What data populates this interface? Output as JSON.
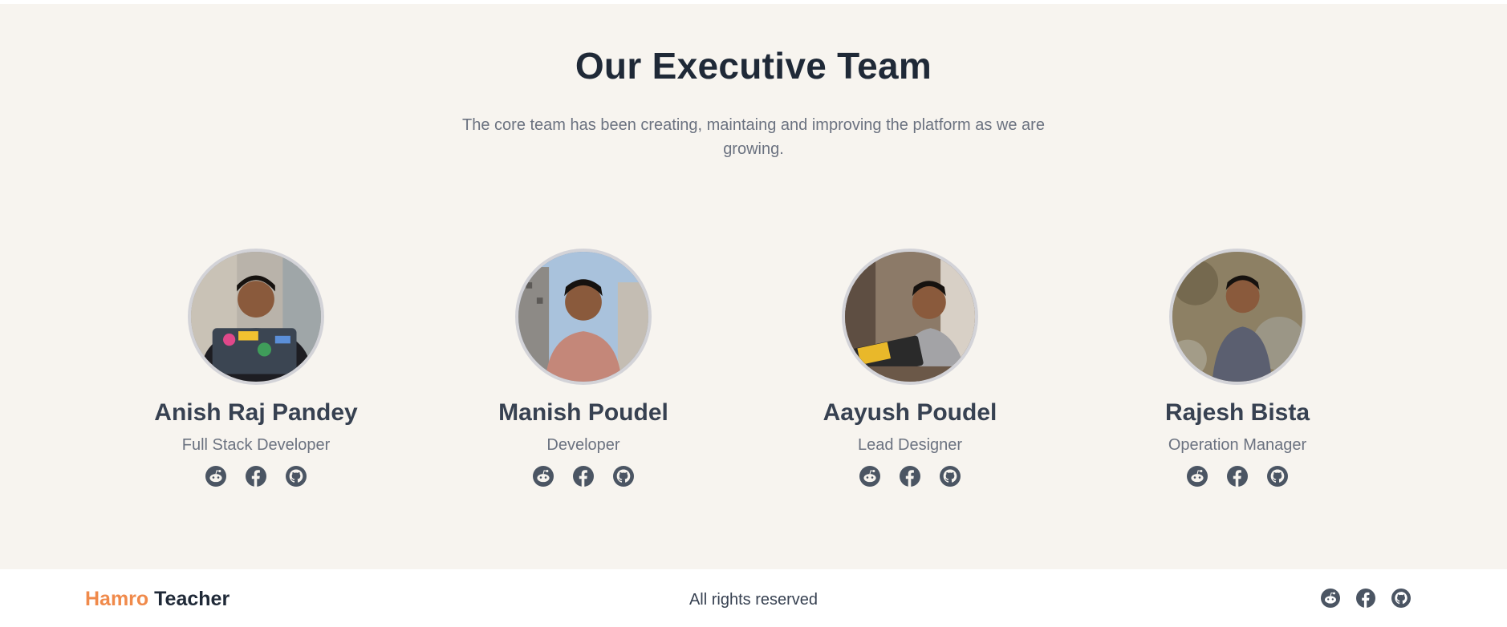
{
  "section": {
    "title": "Our Executive Team",
    "subtitle": "The core team has been creating, maintaing and improving the platform as we are growing."
  },
  "members": [
    {
      "name": "Anish Raj Pandey",
      "role": "Full Stack Developer",
      "socials": [
        "reddit-icon",
        "facebook-icon",
        "github-icon"
      ]
    },
    {
      "name": "Manish Poudel",
      "role": "Developer",
      "socials": [
        "reddit-icon",
        "facebook-icon",
        "github-icon"
      ]
    },
    {
      "name": "Aayush Poudel",
      "role": "Lead Designer",
      "socials": [
        "reddit-icon",
        "facebook-icon",
        "github-icon"
      ]
    },
    {
      "name": "Rajesh Bista",
      "role": "Operation Manager",
      "socials": [
        "reddit-icon",
        "facebook-icon",
        "github-icon"
      ]
    }
  ],
  "footer": {
    "brand_first": "Hamro",
    "brand_second": "Teacher",
    "rights": "All rights reserved",
    "socials": [
      "reddit-icon",
      "facebook-icon",
      "github-icon"
    ]
  },
  "colors": {
    "section_bg": "#f7f4ef",
    "brand_accent": "#f08a4b",
    "icon": "#4b5563"
  }
}
